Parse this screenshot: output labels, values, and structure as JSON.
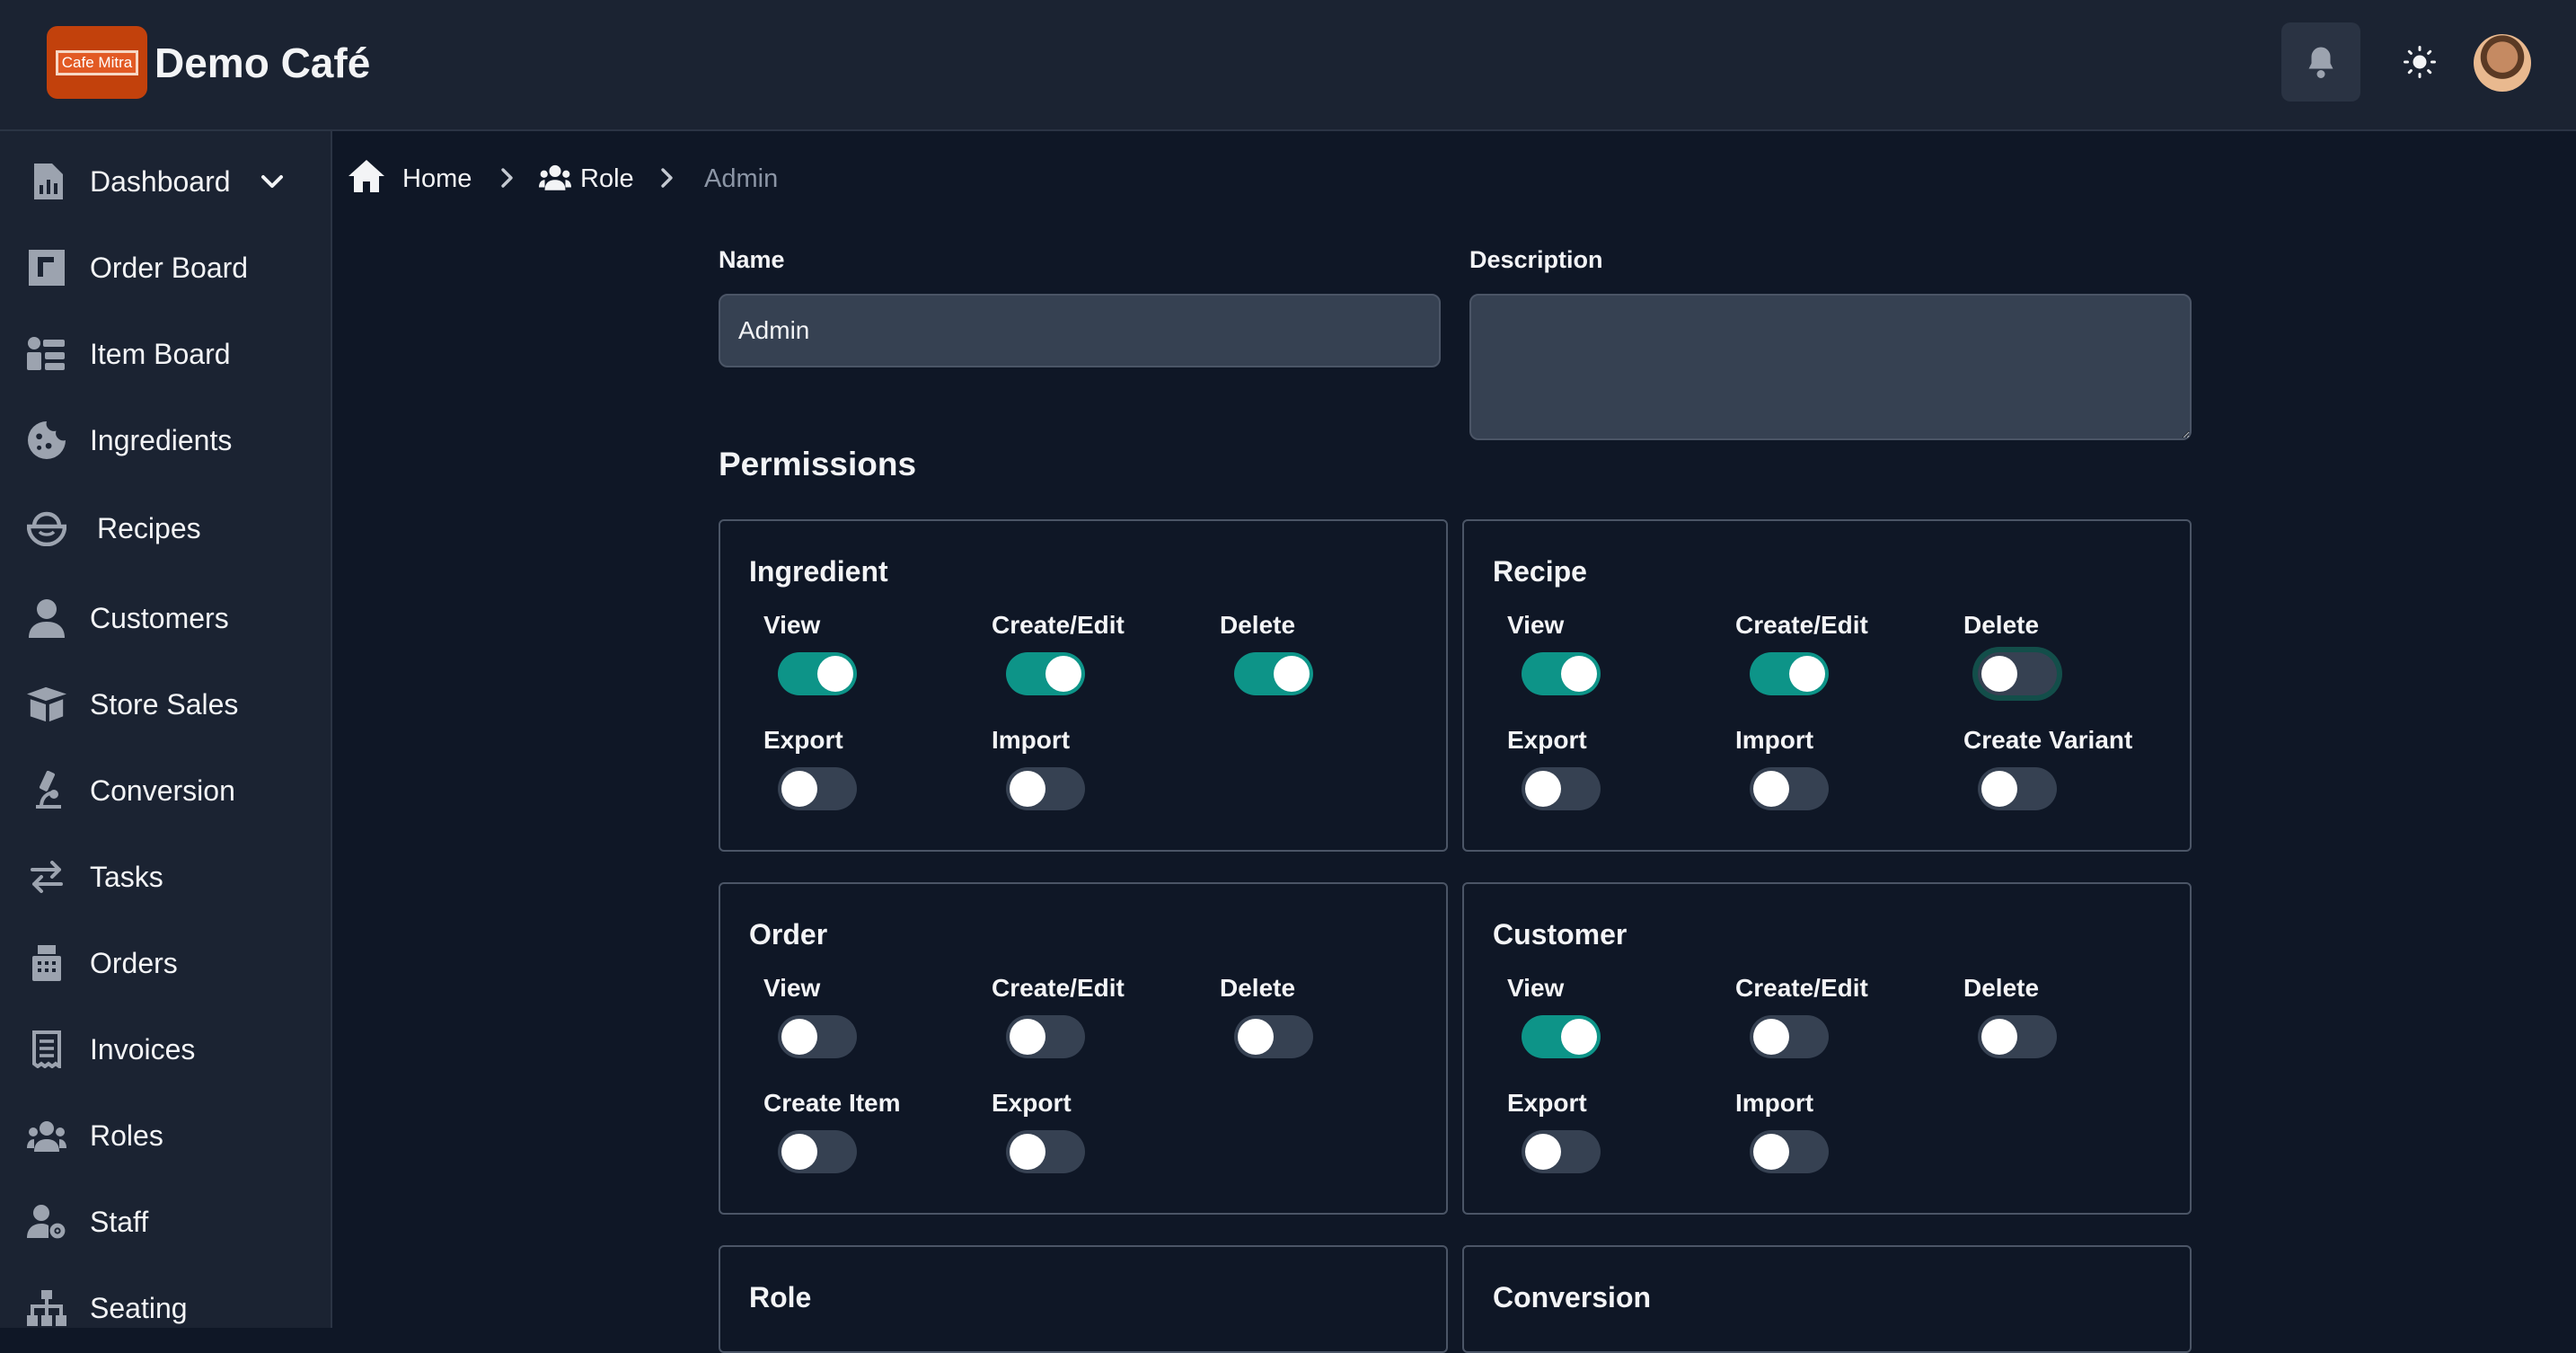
{
  "header": {
    "logo_text": "Cafe Mitra",
    "title": "Demo Café"
  },
  "sidebar": {
    "items": [
      {
        "label": "Dashboard",
        "icon": "chart-icon"
      },
      {
        "label": "Order Board",
        "icon": "board-icon"
      },
      {
        "label": "Item Board",
        "icon": "items-icon"
      },
      {
        "label": "Ingredients",
        "icon": "cookie-icon"
      },
      {
        "label": "Recipes",
        "icon": "bowl-icon"
      },
      {
        "label": "Customers",
        "icon": "user-icon"
      },
      {
        "label": "Store Sales",
        "icon": "box-icon"
      },
      {
        "label": "Conversion",
        "icon": "microscope-icon"
      },
      {
        "label": "Tasks",
        "icon": "arrows-icon"
      },
      {
        "label": "Orders",
        "icon": "register-icon"
      },
      {
        "label": "Invoices",
        "icon": "receipt-icon"
      },
      {
        "label": "Roles",
        "icon": "users-icon"
      },
      {
        "label": "Staff",
        "icon": "user-gear-icon"
      },
      {
        "label": "Seating",
        "icon": "sitemap-icon"
      }
    ]
  },
  "breadcrumb": {
    "home": "Home",
    "role": "Role",
    "current": "Admin"
  },
  "form": {
    "name_label": "Name",
    "name_value": "Admin",
    "description_label": "Description",
    "description_value": "",
    "permissions_title": "Permissions"
  },
  "cards": {
    "ingredient": {
      "title": "Ingredient",
      "perms": [
        {
          "label": "View",
          "on": true
        },
        {
          "label": "Create/Edit",
          "on": true
        },
        {
          "label": "Delete",
          "on": true
        },
        {
          "label": "Export",
          "on": false
        },
        {
          "label": "Import",
          "on": false
        }
      ]
    },
    "recipe": {
      "title": "Recipe",
      "perms": [
        {
          "label": "View",
          "on": true
        },
        {
          "label": "Create/Edit",
          "on": true
        },
        {
          "label": "Delete",
          "on": false
        },
        {
          "label": "Export",
          "on": false
        },
        {
          "label": "Import",
          "on": false
        },
        {
          "label": "Create Variant",
          "on": false
        }
      ]
    },
    "order": {
      "title": "Order",
      "perms": [
        {
          "label": "View",
          "on": false
        },
        {
          "label": "Create/Edit",
          "on": false
        },
        {
          "label": "Delete",
          "on": false
        },
        {
          "label": "Create Item",
          "on": false
        },
        {
          "label": "Export",
          "on": false
        }
      ]
    },
    "customer": {
      "title": "Customer",
      "perms": [
        {
          "label": "View",
          "on": true
        },
        {
          "label": "Create/Edit",
          "on": false
        },
        {
          "label": "Delete",
          "on": false
        },
        {
          "label": "Export",
          "on": false
        },
        {
          "label": "Import",
          "on": false
        }
      ]
    },
    "role": {
      "title": "Role"
    },
    "conversion": {
      "title": "Conversion"
    }
  }
}
